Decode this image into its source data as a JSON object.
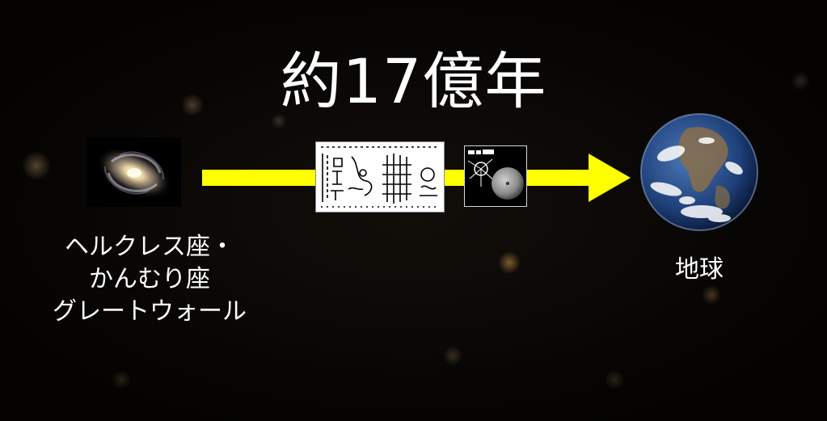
{
  "title": "約17億年",
  "source": {
    "lines": [
      "ヘルクレス座・",
      "かんむり座",
      "グレートウォール"
    ]
  },
  "destination": {
    "label": "地球"
  },
  "icons": {
    "source": "galaxy-icon",
    "destination": "earth-icon",
    "payload_1": "pioneer-plaque-icon",
    "payload_2": "voyager-record-icon",
    "connector": "arrow-right-icon"
  },
  "colors": {
    "background": "#050403",
    "arrow": "#ffff00",
    "text": "#ffffff"
  }
}
